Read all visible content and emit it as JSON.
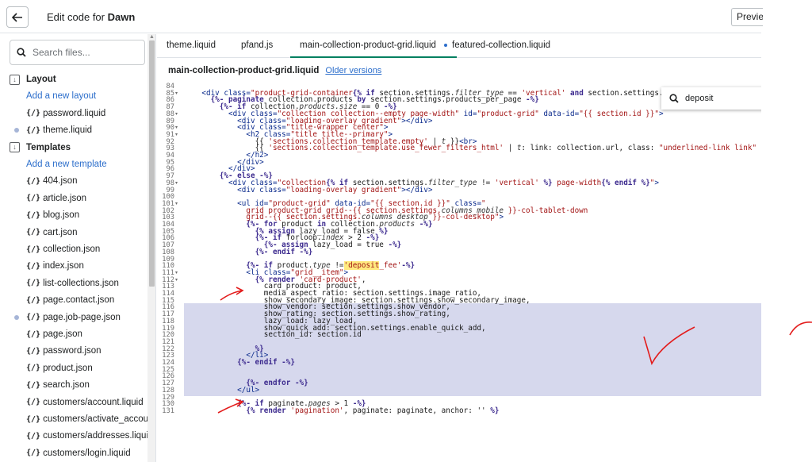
{
  "header": {
    "title_prefix": "Edit code for",
    "title_theme": "Dawn",
    "preview_label": "Preview"
  },
  "sidebar": {
    "search_placeholder": "Search files...",
    "rows": [
      {
        "kind": "folder",
        "label": "Layout"
      },
      {
        "kind": "add",
        "label": "Add a new layout"
      },
      {
        "kind": "file",
        "label": "password.liquid",
        "dot": false
      },
      {
        "kind": "file",
        "label": "theme.liquid",
        "dot": true
      },
      {
        "kind": "folder",
        "label": "Templates"
      },
      {
        "kind": "add",
        "label": "Add a new template"
      },
      {
        "kind": "file",
        "label": "404.json",
        "dot": false
      },
      {
        "kind": "file",
        "label": "article.json",
        "dot": false
      },
      {
        "kind": "file",
        "label": "blog.json",
        "dot": false
      },
      {
        "kind": "file",
        "label": "cart.json",
        "dot": false
      },
      {
        "kind": "file",
        "label": "collection.json",
        "dot": false
      },
      {
        "kind": "file",
        "label": "index.json",
        "dot": false
      },
      {
        "kind": "file",
        "label": "list-collections.json",
        "dot": false
      },
      {
        "kind": "file",
        "label": "page.contact.json",
        "dot": false
      },
      {
        "kind": "file",
        "label": "page.job-page.json",
        "dot": true
      },
      {
        "kind": "file",
        "label": "page.json",
        "dot": false
      },
      {
        "kind": "file",
        "label": "password.json",
        "dot": false
      },
      {
        "kind": "file",
        "label": "product.json",
        "dot": false
      },
      {
        "kind": "file",
        "label": "search.json",
        "dot": false
      },
      {
        "kind": "file",
        "label": "customers/account.liquid",
        "dot": false
      },
      {
        "kind": "file",
        "label": "customers/activate_account.liquid",
        "dot": false
      },
      {
        "kind": "file",
        "label": "customers/addresses.liquid",
        "dot": false
      },
      {
        "kind": "file",
        "label": "customers/login.liquid",
        "dot": false
      }
    ],
    "file_icon": "{/}"
  },
  "tabs": [
    {
      "label": "theme.liquid",
      "active": false,
      "dot": false
    },
    {
      "label": "pfand.js",
      "active": false,
      "dot": false
    },
    {
      "label": "main-collection-product-grid.liquid",
      "active": true,
      "dot": true
    },
    {
      "label": "featured-collection.liquid",
      "active": false,
      "dot": false
    }
  ],
  "file": {
    "name": "main-collection-product-grid.liquid",
    "older_versions": "Older versions"
  },
  "find": {
    "value": "deposit"
  },
  "editor": {
    "lines": [
      [
        84,
        [
          [
            "",
            ""
          ]
        ]
      ],
      [
        85,
        [
          [
            "    ",
            ""
          ],
          [
            "t",
            "<div class="
          ],
          [
            "s",
            "\"product-grid-container"
          ],
          [
            "k",
            "{% if "
          ],
          [
            "",
            "section.settings."
          ],
          [
            "v",
            "filter_type"
          ],
          [
            "",
            " == "
          ],
          [
            "s",
            "'vertical'"
          ],
          [
            "k",
            " and "
          ],
          [
            "",
            "section.settings.co"
          ]
        ]
      ],
      [
        86,
        [
          [
            "      ",
            ""
          ],
          [
            "k",
            "{%- paginate "
          ],
          [
            "",
            "collection.products "
          ],
          [
            "k",
            "by "
          ],
          [
            "",
            "section.settings.products_per_page "
          ],
          [
            "k",
            "-%}"
          ]
        ]
      ],
      [
        87,
        [
          [
            "        ",
            ""
          ],
          [
            "k",
            "{%- if "
          ],
          [
            "",
            "collection."
          ],
          [
            "v",
            "products.size"
          ],
          [
            "",
            " == 0 "
          ],
          [
            "k",
            "-%}"
          ]
        ]
      ],
      [
        88,
        [
          [
            "          ",
            ""
          ],
          [
            "t",
            "<div class="
          ],
          [
            "s",
            "\"collection collection--empty page-width\""
          ],
          [
            "t",
            " id="
          ],
          [
            "s",
            "\"product-grid\""
          ],
          [
            "t",
            " data-id="
          ],
          [
            "s",
            "\"{{ section.id }}\""
          ],
          [
            "t",
            ">"
          ]
        ]
      ],
      [
        89,
        [
          [
            "            ",
            ""
          ],
          [
            "t",
            "<div class="
          ],
          [
            "s",
            "\"loading-overlay gradient\""
          ],
          [
            "t",
            "></div>"
          ]
        ]
      ],
      [
        90,
        [
          [
            "            ",
            ""
          ],
          [
            "t",
            "<div class="
          ],
          [
            "s",
            "\"title-wrapper center\""
          ],
          [
            "t",
            ">"
          ]
        ]
      ],
      [
        91,
        [
          [
            "              ",
            ""
          ],
          [
            "t",
            "<h2 class="
          ],
          [
            "s",
            "\"title title--primary\""
          ],
          [
            "t",
            ">"
          ]
        ]
      ],
      [
        92,
        [
          [
            "                ",
            ""
          ],
          [
            "",
            "{{ "
          ],
          [
            "s",
            "'sections.collection_template.empty'"
          ],
          [
            "",
            " | "
          ],
          [
            "v",
            "t"
          ],
          [
            "",
            " }}"
          ],
          [
            "t",
            "<br>"
          ]
        ]
      ],
      [
        93,
        [
          [
            "                ",
            ""
          ],
          [
            "",
            "{{ "
          ],
          [
            "s",
            "'sections.collection_template.use_fewer_filters_html'"
          ],
          [
            "",
            " | "
          ],
          [
            "v",
            "t"
          ],
          [
            ": link: collection.url, class: ",
            ""
          ],
          [
            "s",
            "\"underlined-link link\""
          ],
          [
            "",
            " }}"
          ]
        ]
      ],
      [
        94,
        [
          [
            "              ",
            ""
          ],
          [
            "t",
            "</h2>"
          ]
        ]
      ],
      [
        95,
        [
          [
            "            ",
            ""
          ],
          [
            "t",
            "</div>"
          ]
        ]
      ],
      [
        96,
        [
          [
            "          ",
            ""
          ],
          [
            "t",
            "</div>"
          ]
        ]
      ],
      [
        97,
        [
          [
            "        ",
            ""
          ],
          [
            "k",
            "{%- else -%}"
          ]
        ]
      ],
      [
        98,
        [
          [
            "          ",
            ""
          ],
          [
            "t",
            "<div class="
          ],
          [
            "s",
            "\"collection"
          ],
          [
            "k",
            "{% if "
          ],
          [
            "",
            "section.settings."
          ],
          [
            "v",
            "filter_type"
          ],
          [
            "",
            " != "
          ],
          [
            "s",
            "'vertical'"
          ],
          [
            "k",
            " %}"
          ],
          [
            "s",
            " page-width"
          ],
          [
            "k",
            "{% endif %}"
          ],
          [
            "s",
            "\""
          ],
          [
            "t",
            ">"
          ]
        ]
      ],
      [
        99,
        [
          [
            "            ",
            ""
          ],
          [
            "t",
            "<div class="
          ],
          [
            "s",
            "\"loading-overlay gradient\""
          ],
          [
            "t",
            "></div>"
          ]
        ]
      ],
      [
        100,
        [
          [
            "",
            ""
          ]
        ]
      ],
      [
        101,
        [
          [
            "            ",
            ""
          ],
          [
            "t",
            "<ul id="
          ],
          [
            "s",
            "\"product-grid\""
          ],
          [
            "t",
            " data-id="
          ],
          [
            "s",
            "\"{{ section.id }}\""
          ],
          [
            "t",
            " class="
          ],
          [
            "s",
            "\""
          ]
        ]
      ],
      [
        102,
        [
          [
            "              ",
            ""
          ],
          [
            "s",
            "grid product-grid grid--{{ section.settings."
          ],
          [
            "v",
            "columns_mobile"
          ],
          [
            "s",
            " }}-col-tablet-down"
          ]
        ]
      ],
      [
        103,
        [
          [
            "              ",
            ""
          ],
          [
            "s",
            "grid--{{ section.settings."
          ],
          [
            "v",
            "columns_desktop"
          ],
          [
            "s",
            " }}-col-desktop\""
          ],
          [
            "t",
            ">"
          ]
        ]
      ],
      [
        104,
        [
          [
            "              ",
            ""
          ],
          [
            "k",
            "{%- for "
          ],
          [
            "",
            "product "
          ],
          [
            "k",
            "in "
          ],
          [
            "",
            "collection."
          ],
          [
            "v",
            "products"
          ],
          [
            "",
            " "
          ],
          [
            "k",
            "-%}"
          ]
        ]
      ],
      [
        105,
        [
          [
            "                ",
            ""
          ],
          [
            "k",
            "{% assign "
          ],
          [
            "",
            "lazy_load = false "
          ],
          [
            "k",
            "%}"
          ]
        ]
      ],
      [
        106,
        [
          [
            "                ",
            ""
          ],
          [
            "k",
            "{%- if "
          ],
          [
            "",
            "forloop."
          ],
          [
            "v",
            "index"
          ],
          [
            "",
            " > 2 "
          ],
          [
            "k",
            "-%}"
          ]
        ]
      ],
      [
        107,
        [
          [
            "                  ",
            ""
          ],
          [
            "k",
            "{%- assign "
          ],
          [
            "",
            "lazy_load = true "
          ],
          [
            "k",
            "-%}"
          ]
        ]
      ],
      [
        108,
        [
          [
            "                ",
            ""
          ],
          [
            "k",
            "{%- endif -%}"
          ]
        ]
      ],
      [
        109,
        [
          [
            "",
            ""
          ]
        ]
      ],
      [
        110,
        [
          [
            "              ",
            ""
          ],
          [
            "k",
            "{%- if "
          ],
          [
            "",
            "product."
          ],
          [
            "v",
            "type"
          ],
          [
            "",
            " !="
          ],
          [
            "hl",
            "'deposit"
          ],
          [
            "s",
            "_fee'"
          ],
          [
            "k",
            "-%}"
          ]
        ]
      ],
      [
        111,
        [
          [
            "              ",
            ""
          ],
          [
            "t",
            "<li class="
          ],
          [
            "s",
            "\"grid__item\""
          ],
          [
            "t",
            ">"
          ]
        ]
      ],
      [
        112,
        [
          [
            "                ",
            ""
          ],
          [
            "k",
            "{% render "
          ],
          [
            "s",
            "'card-product'"
          ],
          [
            ",",
            ""
          ]
        ]
      ],
      [
        113,
        [
          [
            "                  ",
            ""
          ],
          [
            "",
            "card_product: product,"
          ]
        ]
      ],
      [
        114,
        [
          [
            "                  ",
            ""
          ],
          [
            "",
            "media_aspect_ratio: section.settings.image_ratio,"
          ]
        ]
      ],
      [
        115,
        [
          [
            "                  ",
            ""
          ],
          [
            "",
            "show_secondary_image: section.settings.show_secondary_image,"
          ]
        ]
      ],
      [
        116,
        [
          [
            "                  ",
            ""
          ],
          [
            "",
            "show_vendor: section.settings.show_vendor,"
          ]
        ]
      ],
      [
        117,
        [
          [
            "                  ",
            ""
          ],
          [
            "",
            "show_rating: section.settings.show_rating,"
          ]
        ]
      ],
      [
        118,
        [
          [
            "                  ",
            ""
          ],
          [
            "",
            "lazy_load: lazy_load,"
          ]
        ]
      ],
      [
        119,
        [
          [
            "                  ",
            ""
          ],
          [
            "",
            "show_quick_add: section.settings.enable_quick_add,"
          ]
        ]
      ],
      [
        120,
        [
          [
            "                  ",
            ""
          ],
          [
            "",
            "section_id: section.id"
          ]
        ]
      ],
      [
        121,
        [
          [
            "",
            ""
          ]
        ]
      ],
      [
        122,
        [
          [
            "                ",
            ""
          ],
          [
            "k",
            "%}"
          ]
        ]
      ],
      [
        123,
        [
          [
            "              ",
            ""
          ],
          [
            "t",
            "</li>"
          ]
        ]
      ],
      [
        124,
        [
          [
            "            ",
            ""
          ],
          [
            "k",
            "{%- endif -%}"
          ]
        ]
      ],
      [
        125,
        [
          [
            "",
            ""
          ]
        ]
      ],
      [
        126,
        [
          [
            "",
            ""
          ]
        ]
      ],
      [
        127,
        [
          [
            "              ",
            ""
          ],
          [
            "k",
            "{%- endfor -%}"
          ]
        ]
      ],
      [
        128,
        [
          [
            "            ",
            ""
          ],
          [
            "t",
            "</ul>"
          ]
        ]
      ],
      [
        129,
        [
          [
            "",
            ""
          ]
        ]
      ],
      [
        130,
        [
          [
            "            ",
            ""
          ],
          [
            "k",
            "{%- if "
          ],
          [
            "",
            "paginate."
          ],
          [
            "v",
            "pages"
          ],
          [
            "",
            " > 1 "
          ],
          [
            "k",
            "-%}"
          ]
        ]
      ],
      [
        131,
        [
          [
            "              ",
            ""
          ],
          [
            "k",
            "{% render "
          ],
          [
            "s",
            "'pagination'"
          ],
          [
            ", paginate: paginate, anchor: '' ",
            ""
          ],
          [
            "k",
            "%}"
          ]
        ]
      ]
    ],
    "fold_lines": [
      85,
      88,
      90,
      91,
      98,
      101,
      111,
      112
    ]
  }
}
